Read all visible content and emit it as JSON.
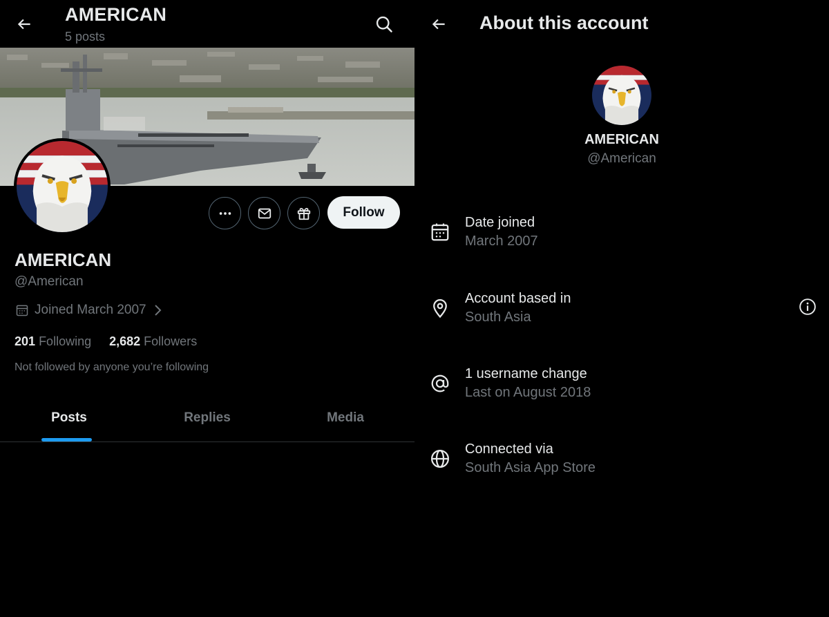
{
  "profile": {
    "title": "AMERICAN",
    "post_count": "5 posts",
    "name": "AMERICAN",
    "handle": "@American",
    "joined": "Joined March 2007",
    "following_count": "201",
    "following_label": "Following",
    "followers_count": "2,682",
    "followers_label": "Followers",
    "not_followed": "Not followed by anyone you’re following",
    "follow_label": "Follow"
  },
  "tabs": [
    {
      "label": "Posts",
      "active": true
    },
    {
      "label": "Replies",
      "active": false
    },
    {
      "label": "Media",
      "active": false
    }
  ],
  "about": {
    "title": "About this account",
    "name": "AMERICAN",
    "handle": "@American",
    "rows": [
      {
        "icon": "calendar-icon",
        "label": "Date joined",
        "value": "March 2007"
      },
      {
        "icon": "location-pin-icon",
        "label": "Account based in",
        "value": "South Asia"
      },
      {
        "icon": "at-sign-icon",
        "label": "1 username change",
        "value": "Last on August 2018"
      },
      {
        "icon": "globe-icon",
        "label": "Connected via",
        "value": "South Asia App Store"
      }
    ]
  },
  "colors": {
    "background": "#000000",
    "primary_text": "#e7e9ea",
    "secondary_text": "#71767b",
    "accent": "#1d9bf0",
    "follow_button_bg": "#eff3f4"
  }
}
